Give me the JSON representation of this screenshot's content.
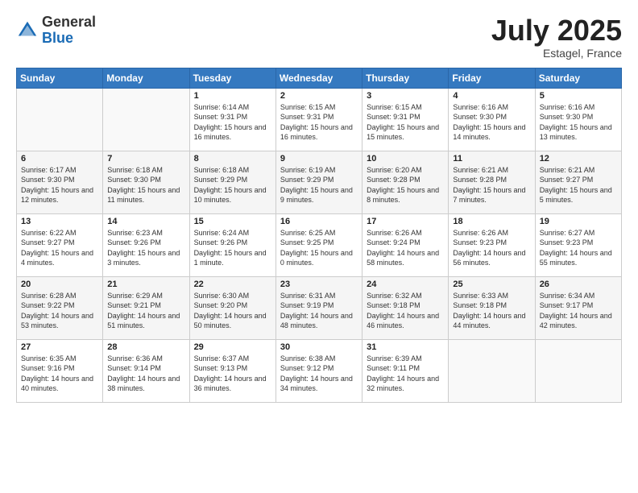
{
  "header": {
    "logo_general": "General",
    "logo_blue": "Blue",
    "month": "July 2025",
    "location": "Estagel, France"
  },
  "weekdays": [
    "Sunday",
    "Monday",
    "Tuesday",
    "Wednesday",
    "Thursday",
    "Friday",
    "Saturday"
  ],
  "weeks": [
    [
      {
        "day": "",
        "info": ""
      },
      {
        "day": "",
        "info": ""
      },
      {
        "day": "1",
        "info": "Sunrise: 6:14 AM\nSunset: 9:31 PM\nDaylight: 15 hours and 16 minutes."
      },
      {
        "day": "2",
        "info": "Sunrise: 6:15 AM\nSunset: 9:31 PM\nDaylight: 15 hours and 16 minutes."
      },
      {
        "day": "3",
        "info": "Sunrise: 6:15 AM\nSunset: 9:31 PM\nDaylight: 15 hours and 15 minutes."
      },
      {
        "day": "4",
        "info": "Sunrise: 6:16 AM\nSunset: 9:30 PM\nDaylight: 15 hours and 14 minutes."
      },
      {
        "day": "5",
        "info": "Sunrise: 6:16 AM\nSunset: 9:30 PM\nDaylight: 15 hours and 13 minutes."
      }
    ],
    [
      {
        "day": "6",
        "info": "Sunrise: 6:17 AM\nSunset: 9:30 PM\nDaylight: 15 hours and 12 minutes."
      },
      {
        "day": "7",
        "info": "Sunrise: 6:18 AM\nSunset: 9:30 PM\nDaylight: 15 hours and 11 minutes."
      },
      {
        "day": "8",
        "info": "Sunrise: 6:18 AM\nSunset: 9:29 PM\nDaylight: 15 hours and 10 minutes."
      },
      {
        "day": "9",
        "info": "Sunrise: 6:19 AM\nSunset: 9:29 PM\nDaylight: 15 hours and 9 minutes."
      },
      {
        "day": "10",
        "info": "Sunrise: 6:20 AM\nSunset: 9:28 PM\nDaylight: 15 hours and 8 minutes."
      },
      {
        "day": "11",
        "info": "Sunrise: 6:21 AM\nSunset: 9:28 PM\nDaylight: 15 hours and 7 minutes."
      },
      {
        "day": "12",
        "info": "Sunrise: 6:21 AM\nSunset: 9:27 PM\nDaylight: 15 hours and 5 minutes."
      }
    ],
    [
      {
        "day": "13",
        "info": "Sunrise: 6:22 AM\nSunset: 9:27 PM\nDaylight: 15 hours and 4 minutes."
      },
      {
        "day": "14",
        "info": "Sunrise: 6:23 AM\nSunset: 9:26 PM\nDaylight: 15 hours and 3 minutes."
      },
      {
        "day": "15",
        "info": "Sunrise: 6:24 AM\nSunset: 9:26 PM\nDaylight: 15 hours and 1 minute."
      },
      {
        "day": "16",
        "info": "Sunrise: 6:25 AM\nSunset: 9:25 PM\nDaylight: 15 hours and 0 minutes."
      },
      {
        "day": "17",
        "info": "Sunrise: 6:26 AM\nSunset: 9:24 PM\nDaylight: 14 hours and 58 minutes."
      },
      {
        "day": "18",
        "info": "Sunrise: 6:26 AM\nSunset: 9:23 PM\nDaylight: 14 hours and 56 minutes."
      },
      {
        "day": "19",
        "info": "Sunrise: 6:27 AM\nSunset: 9:23 PM\nDaylight: 14 hours and 55 minutes."
      }
    ],
    [
      {
        "day": "20",
        "info": "Sunrise: 6:28 AM\nSunset: 9:22 PM\nDaylight: 14 hours and 53 minutes."
      },
      {
        "day": "21",
        "info": "Sunrise: 6:29 AM\nSunset: 9:21 PM\nDaylight: 14 hours and 51 minutes."
      },
      {
        "day": "22",
        "info": "Sunrise: 6:30 AM\nSunset: 9:20 PM\nDaylight: 14 hours and 50 minutes."
      },
      {
        "day": "23",
        "info": "Sunrise: 6:31 AM\nSunset: 9:19 PM\nDaylight: 14 hours and 48 minutes."
      },
      {
        "day": "24",
        "info": "Sunrise: 6:32 AM\nSunset: 9:18 PM\nDaylight: 14 hours and 46 minutes."
      },
      {
        "day": "25",
        "info": "Sunrise: 6:33 AM\nSunset: 9:18 PM\nDaylight: 14 hours and 44 minutes."
      },
      {
        "day": "26",
        "info": "Sunrise: 6:34 AM\nSunset: 9:17 PM\nDaylight: 14 hours and 42 minutes."
      }
    ],
    [
      {
        "day": "27",
        "info": "Sunrise: 6:35 AM\nSunset: 9:16 PM\nDaylight: 14 hours and 40 minutes."
      },
      {
        "day": "28",
        "info": "Sunrise: 6:36 AM\nSunset: 9:14 PM\nDaylight: 14 hours and 38 minutes."
      },
      {
        "day": "29",
        "info": "Sunrise: 6:37 AM\nSunset: 9:13 PM\nDaylight: 14 hours and 36 minutes."
      },
      {
        "day": "30",
        "info": "Sunrise: 6:38 AM\nSunset: 9:12 PM\nDaylight: 14 hours and 34 minutes."
      },
      {
        "day": "31",
        "info": "Sunrise: 6:39 AM\nSunset: 9:11 PM\nDaylight: 14 hours and 32 minutes."
      },
      {
        "day": "",
        "info": ""
      },
      {
        "day": "",
        "info": ""
      }
    ]
  ]
}
